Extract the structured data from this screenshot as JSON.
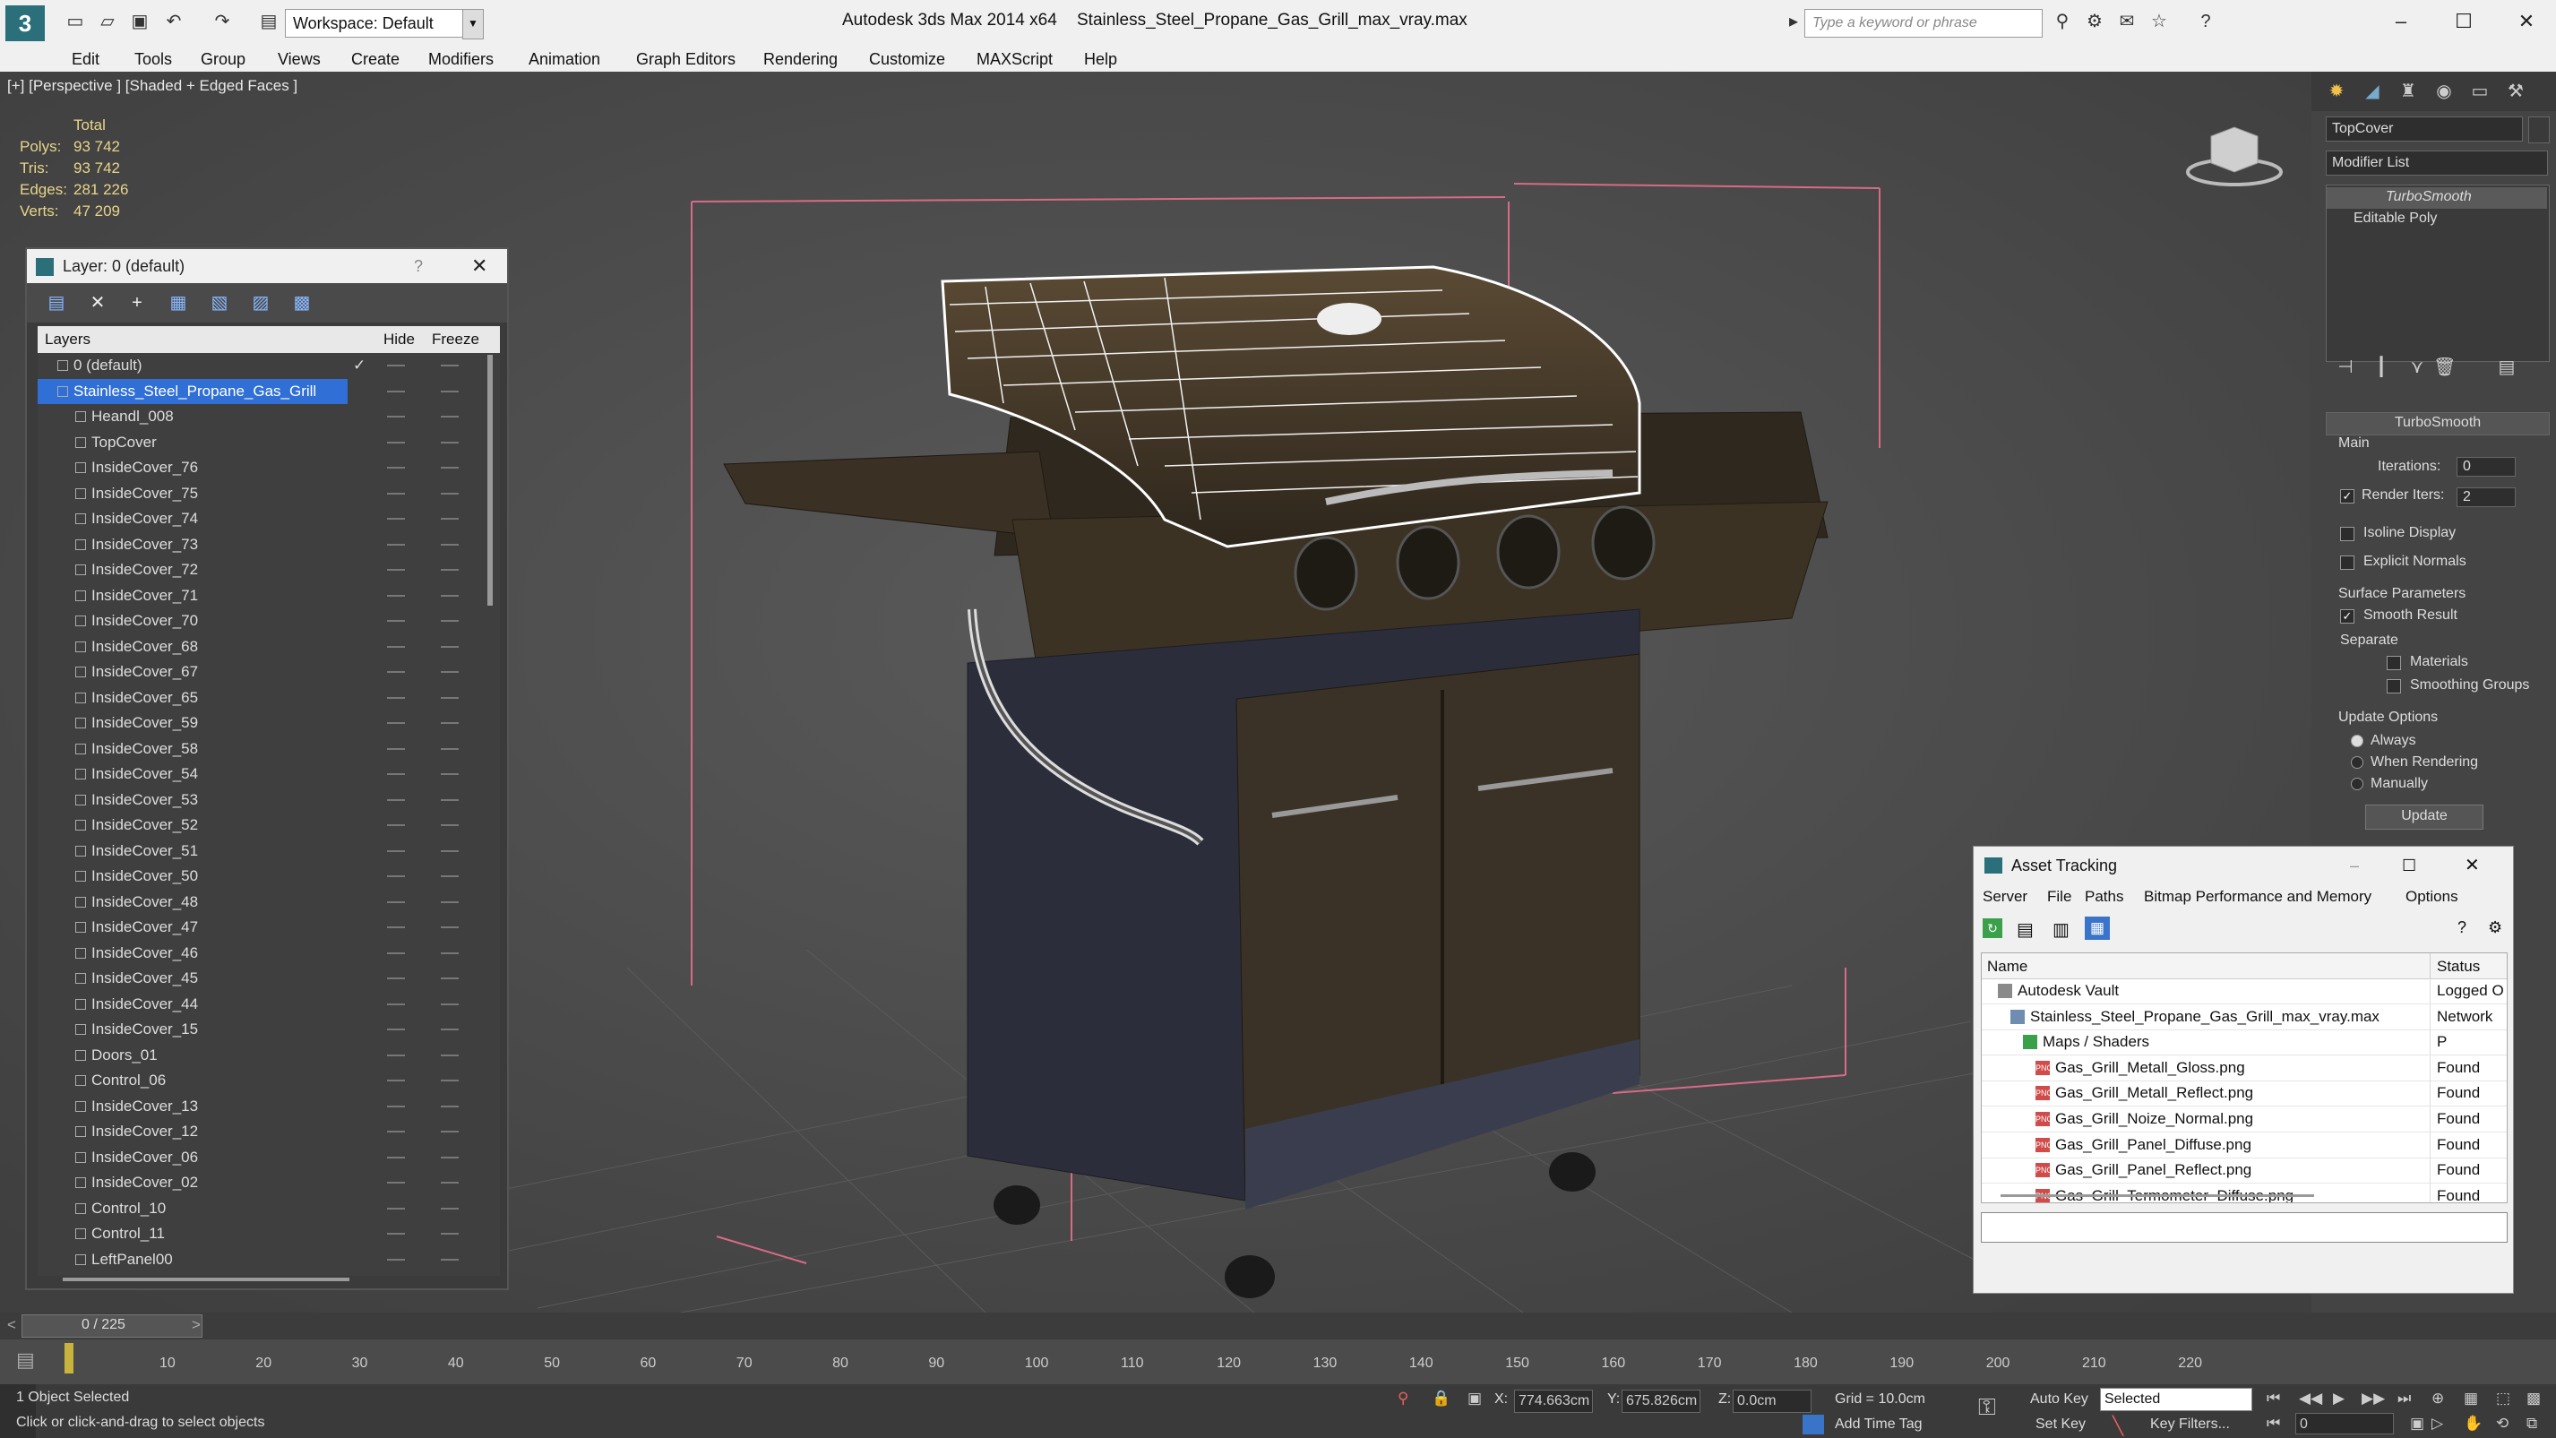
{
  "titlebar": {
    "workspace": "Workspace: Default",
    "app": "Autodesk 3ds Max  2014 x64",
    "file": "Stainless_Steel_Propane_Gas_Grill_max_vray.max",
    "search_placeholder": "Type a keyword or phrase"
  },
  "menubar": [
    "Edit",
    "Tools",
    "Group",
    "Views",
    "Create",
    "Modifiers",
    "Animation",
    "Graph Editors",
    "Rendering",
    "Customize",
    "MAXScript",
    "Help"
  ],
  "viewport": {
    "label": "[+] [Perspective ] [Shaded + Edged Faces ]",
    "stats": {
      "header": "Total",
      "rows": [
        {
          "label": "Polys:",
          "value": "93 742"
        },
        {
          "label": "Tris:",
          "value": "93 742"
        },
        {
          "label": "Edges:",
          "value": "281 226"
        },
        {
          "label": "Verts:",
          "value": "47 209"
        }
      ]
    }
  },
  "layer_panel": {
    "title": "Layer: 0 (default)",
    "help": "?",
    "columns": {
      "layers": "Layers",
      "hide": "Hide",
      "freeze": "Freeze"
    },
    "layers": [
      {
        "name": "0 (default)",
        "level": 0,
        "checked": true
      },
      {
        "name": "Stainless_Steel_Propane_Gas_Grill",
        "level": 0,
        "selected": true
      }
    ],
    "objects": [
      "Heandl_008",
      "TopCover",
      "InsideCover_76",
      "InsideCover_75",
      "InsideCover_74",
      "InsideCover_73",
      "InsideCover_72",
      "InsideCover_71",
      "InsideCover_70",
      "InsideCover_68",
      "InsideCover_67",
      "InsideCover_65",
      "InsideCover_59",
      "InsideCover_58",
      "InsideCover_54",
      "InsideCover_53",
      "InsideCover_52",
      "InsideCover_51",
      "InsideCover_50",
      "InsideCover_48",
      "InsideCover_47",
      "InsideCover_46",
      "InsideCover_45",
      "InsideCover_44",
      "InsideCover_15",
      "Doors_01",
      "Control_06",
      "InsideCover_13",
      "InsideCover_12",
      "InsideCover_06",
      "InsideCover_02",
      "Control_10",
      "Control_11",
      "LeftPanel00"
    ]
  },
  "command_panel": {
    "object_name": "TopCover",
    "modifier_list": "Modifier List",
    "stack": [
      "TurboSmooth",
      "Editable Poly"
    ],
    "rollout_title": "TurboSmooth",
    "main": "Main",
    "iterations_label": "Iterations:",
    "iterations": "0",
    "render_iters_label": "Render Iters:",
    "render_iters": "2",
    "isoline": "Isoline Display",
    "explicit": "Explicit Normals",
    "surface": "Surface Parameters",
    "smooth_result": "Smooth Result",
    "separate": "Separate",
    "materials": "Materials",
    "smoothing_groups": "Smoothing Groups",
    "update_options": "Update Options",
    "always": "Always",
    "when_rendering": "When Rendering",
    "manually": "Manually",
    "update_button": "Update"
  },
  "asset_tracking": {
    "title": "Asset Tracking",
    "menu": [
      "Server",
      "File",
      "Paths",
      "Bitmap Performance and Memory",
      "Options"
    ],
    "columns": {
      "name": "Name",
      "status": "Status"
    },
    "rows": [
      {
        "name": "Autodesk Vault",
        "status": "Logged O",
        "indent": 1
      },
      {
        "name": "Stainless_Steel_Propane_Gas_Grill_max_vray.max",
        "status": "Network P",
        "indent": 2
      },
      {
        "name": "Maps / Shaders",
        "status": "",
        "indent": 3
      },
      {
        "name": "Gas_Grill_Metall_Gloss.png",
        "status": "Found",
        "indent": 4
      },
      {
        "name": "Gas_Grill_Metall_Reflect.png",
        "status": "Found",
        "indent": 4
      },
      {
        "name": "Gas_Grill_Noize_Normal.png",
        "status": "Found",
        "indent": 4
      },
      {
        "name": "Gas_Grill_Panel_Diffuse.png",
        "status": "Found",
        "indent": 4
      },
      {
        "name": "Gas_Grill_Panel_Reflect.png",
        "status": "Found",
        "indent": 4
      },
      {
        "name": "Gas_Grill_Termometer_Diffuse.png",
        "status": "Found",
        "indent": 4
      }
    ]
  },
  "timeline": {
    "frame": "0 / 225",
    "ticks": [
      "10",
      "20",
      "30",
      "40",
      "50",
      "60",
      "70",
      "80",
      "90",
      "100",
      "110",
      "120",
      "130",
      "140",
      "150",
      "160",
      "170",
      "180",
      "190",
      "200",
      "210",
      "220"
    ]
  },
  "statusbar": {
    "selected": "1 Object Selected",
    "prompt": "Click or click-and-drag to select objects",
    "x_label": "X:",
    "x": "774.663cm",
    "y_label": "Y:",
    "y": "675.826cm",
    "z_label": "Z:",
    "z": "0.0cm",
    "grid": "Grid = 10.0cm",
    "add_time_tag": "Add Time Tag",
    "auto_key": "Auto Key",
    "auto_key_mode": "Selected",
    "set_key": "Set Key",
    "key_filters": "Key Filters...",
    "frame_value": "0"
  }
}
